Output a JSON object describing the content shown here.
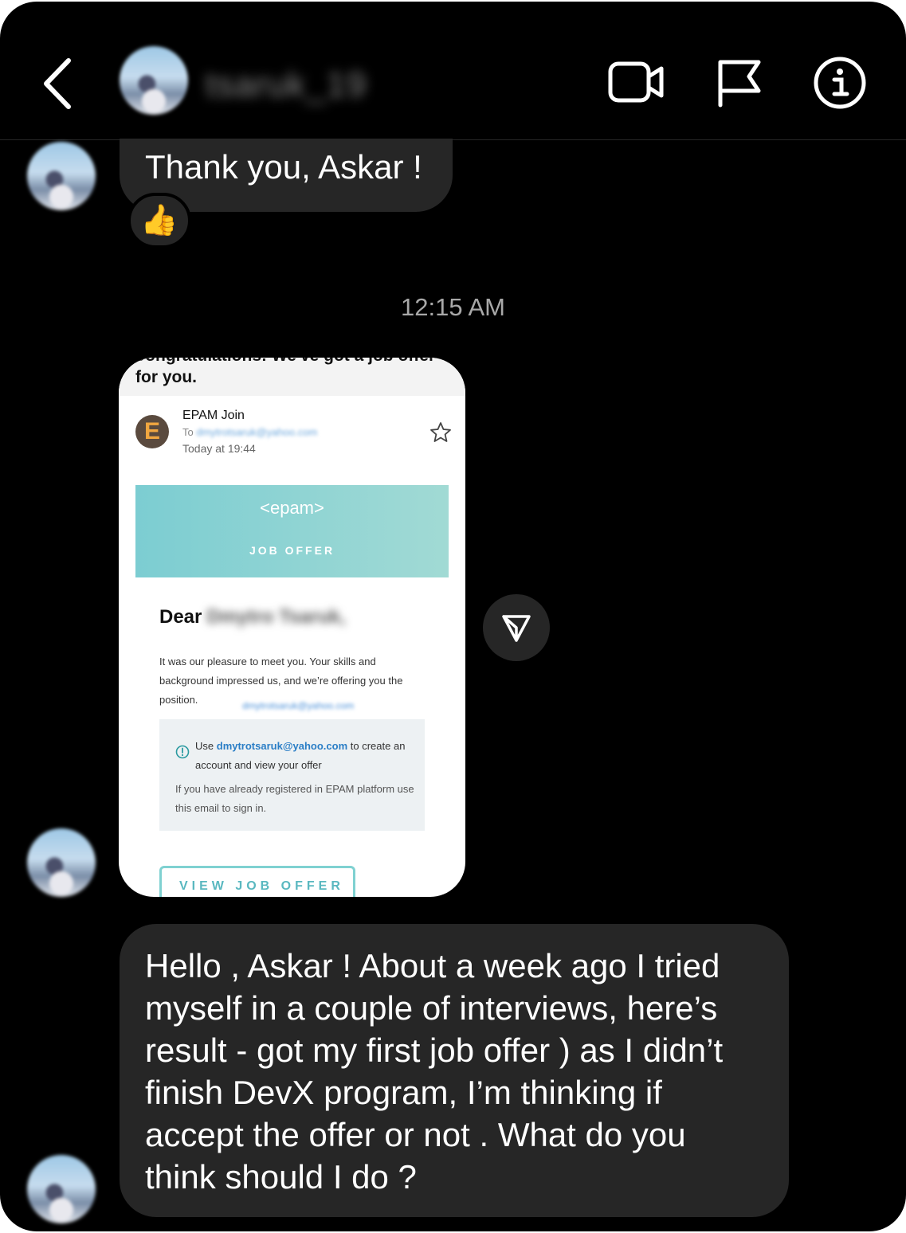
{
  "header": {
    "username": "tsaruk_19",
    "back_icon": "chevron-left-icon",
    "video_icon": "video-camera-icon",
    "flag_icon": "flag-icon",
    "info_icon": "info-icon"
  },
  "messages": {
    "first": "Thank you, Askar !",
    "reaction": "👍",
    "timestamp": "12:15 AM",
    "last": "Hello , Askar ! About a week ago I tried myself in a couple of interviews, here’s result - got my first job offer ) as I didn’t finish DevX program, I’m thinking if accept the offer or not . What do you think should I do ?"
  },
  "email": {
    "subject_cut": "Congratulations! We've got a job offer",
    "subject_end": "for you.",
    "sender_initial": "E",
    "sender": "EPAM Join",
    "to_label": "To",
    "to_address": "dmytrotsaruk@yahoo.com",
    "time": "Today at 19:44",
    "logo": "<epam>",
    "banner_title": "JOB OFFER",
    "dear": "Dear",
    "dear_name": "Dmytro Tsaruk,",
    "body": "It was our pleasure to meet you. Your skills and background impressed us, and we’re offering you the position.",
    "blurred_email": "dmytrotsaruk@yahoo.com",
    "notice_prefix": "Use",
    "notice_email": "dmytrotsaruk@yahoo.com",
    "notice_suffix": "to create an account and view your offer",
    "notice_more": "If you have already registered in EPAM platform use this email to sign in.",
    "button": "VIEW JOB OFFER"
  },
  "colors": {
    "background": "#000000",
    "bubble": "#262626",
    "banner": "#7ccdd2",
    "link": "#2a7ec6"
  }
}
